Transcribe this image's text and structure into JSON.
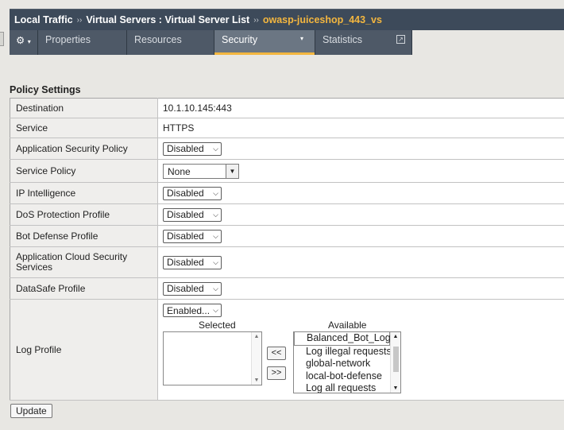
{
  "breadcrumb": {
    "items": [
      "Local Traffic",
      "Virtual Servers : Virtual Server List"
    ],
    "separator": "››",
    "current": "owasp-juiceshop_443_vs"
  },
  "tabs": {
    "gear_icon": "⚙",
    "gear_caret": "▾",
    "properties": "Properties",
    "resources": "Resources",
    "security": "Security",
    "security_caret": "▾",
    "statistics": "Statistics",
    "popout_icon": "↗"
  },
  "section_title": "Policy Settings",
  "rows": {
    "destination": {
      "label": "Destination",
      "value": "10.1.10.145:443"
    },
    "service": {
      "label": "Service",
      "value": "HTTPS"
    },
    "app_security_policy": {
      "label": "Application Security Policy",
      "value": "Disabled"
    },
    "service_policy": {
      "label": "Service Policy",
      "value": "None"
    },
    "ip_intelligence": {
      "label": "IP Intelligence",
      "value": "Disabled"
    },
    "dos_profile": {
      "label": "DoS Protection Profile",
      "value": "Disabled"
    },
    "bot_defense": {
      "label": "Bot Defense Profile",
      "value": "Disabled"
    },
    "app_cloud_security": {
      "label": "Application Cloud Security Services",
      "value": "Disabled"
    },
    "datasafe": {
      "label": "DataSafe Profile",
      "value": "Disabled"
    },
    "log_profile": {
      "label": "Log Profile",
      "value": "Enabled...",
      "selected_label": "Selected",
      "available_label": "Available",
      "available_items": [
        "Balanced_Bot_Log",
        "Log illegal requests",
        "global-network",
        "local-bot-defense",
        "Log all requests"
      ],
      "move_left": "<<",
      "move_right": ">>"
    }
  },
  "update_button": "Update"
}
